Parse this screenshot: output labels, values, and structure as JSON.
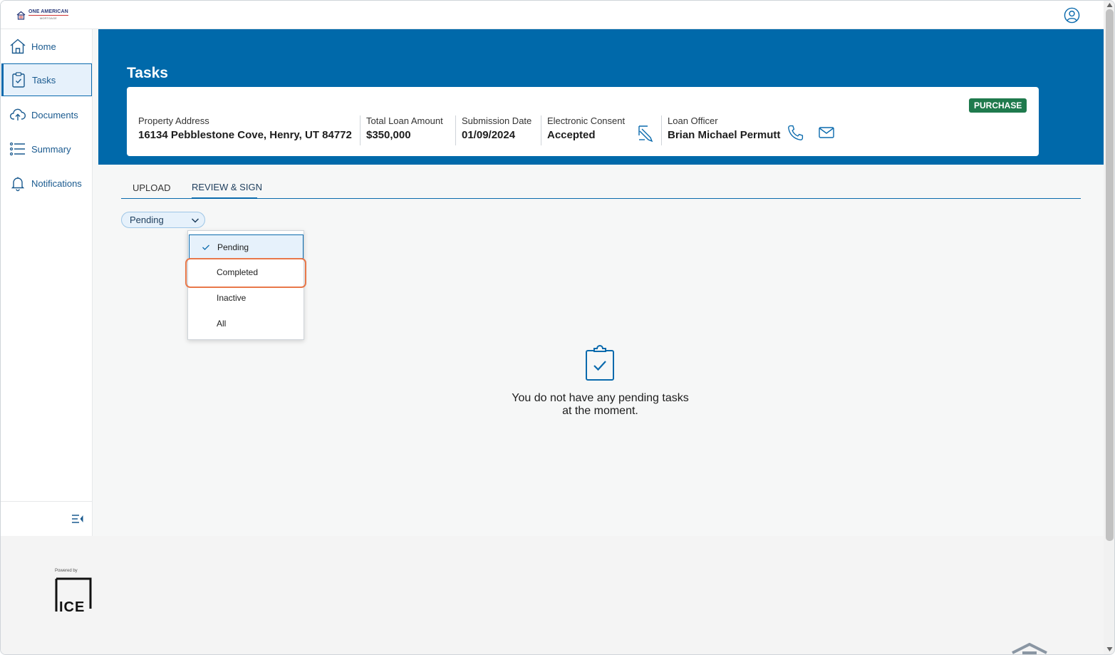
{
  "brand": {
    "logo_line1": "ONE AMERICAN",
    "logo_line2": "MORTGAGE"
  },
  "sidebar": {
    "items": [
      {
        "label": "Home",
        "icon": "home-icon"
      },
      {
        "label": "Tasks",
        "icon": "clipboard-check-icon",
        "active": true
      },
      {
        "label": "Documents",
        "icon": "cloud-upload-icon"
      },
      {
        "label": "Summary",
        "icon": "list-icon"
      },
      {
        "label": "Notifications",
        "icon": "bell-icon"
      }
    ]
  },
  "page": {
    "title": "Tasks"
  },
  "loan": {
    "badge": "PURCHASE",
    "property_address_label": "Property Address",
    "property_address": "16134 Pebblestone Cove, Henry, UT 84772",
    "total_loan_label": "Total Loan Amount",
    "total_loan": "$350,000",
    "submission_label": "Submission Date",
    "submission_date": "01/09/2024",
    "consent_label": "Electronic Consent",
    "consent_value": "Accepted",
    "officer_label": "Loan Officer",
    "officer_name": "Brian Michael Permutt"
  },
  "tabs": [
    {
      "label": "UPLOAD"
    },
    {
      "label": "REVIEW & SIGN",
      "active": true
    }
  ],
  "filter": {
    "selected": "Pending",
    "options": [
      "Pending",
      "Completed",
      "Inactive",
      "All"
    ]
  },
  "empty_state": {
    "line1": "You do not have any pending tasks",
    "line2": "at the moment."
  },
  "footer": {
    "powered_by": "Powered by",
    "ice_logo_text": "ICE"
  },
  "colors": {
    "brand_blue": "#0069aa",
    "accent": "#0a6aad",
    "badge_green": "#1f7a4d",
    "highlight": "#e8784a"
  }
}
